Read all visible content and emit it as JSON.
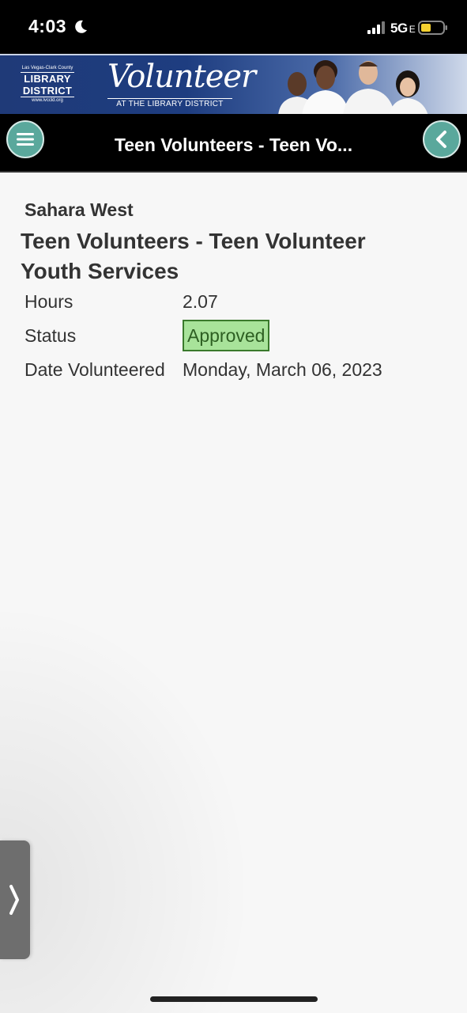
{
  "status_bar": {
    "time": "4:03",
    "network": "5G",
    "network_suffix": "E"
  },
  "banner": {
    "logo_top": "Las Vegas-Clark County",
    "logo_line1": "LIBRARY",
    "logo_line2": "DISTRICT",
    "logo_url": "www.lvccld.org",
    "title": "Volunteer",
    "subtitle": "AT THE LIBRARY DISTRICT"
  },
  "nav": {
    "title": "Teen Volunteers - Teen Vo..."
  },
  "entry": {
    "location": "Sahara West",
    "title": "Teen Volunteers - Teen Volunteer Youth Services",
    "fields": [
      {
        "label": "Hours",
        "value": "2.07"
      },
      {
        "label": "Status",
        "value": "Approved"
      },
      {
        "label": "Date Volunteered",
        "value": "Monday, March 06, 2023"
      }
    ]
  },
  "colors": {
    "accent": "#5aa89c",
    "approved_bg": "#a8e39a",
    "approved_border": "#3a7a2c"
  },
  "icons": {
    "menu": "hamburger-menu-icon",
    "back": "chevron-left-icon",
    "drawer": "chevron-right-icon"
  }
}
